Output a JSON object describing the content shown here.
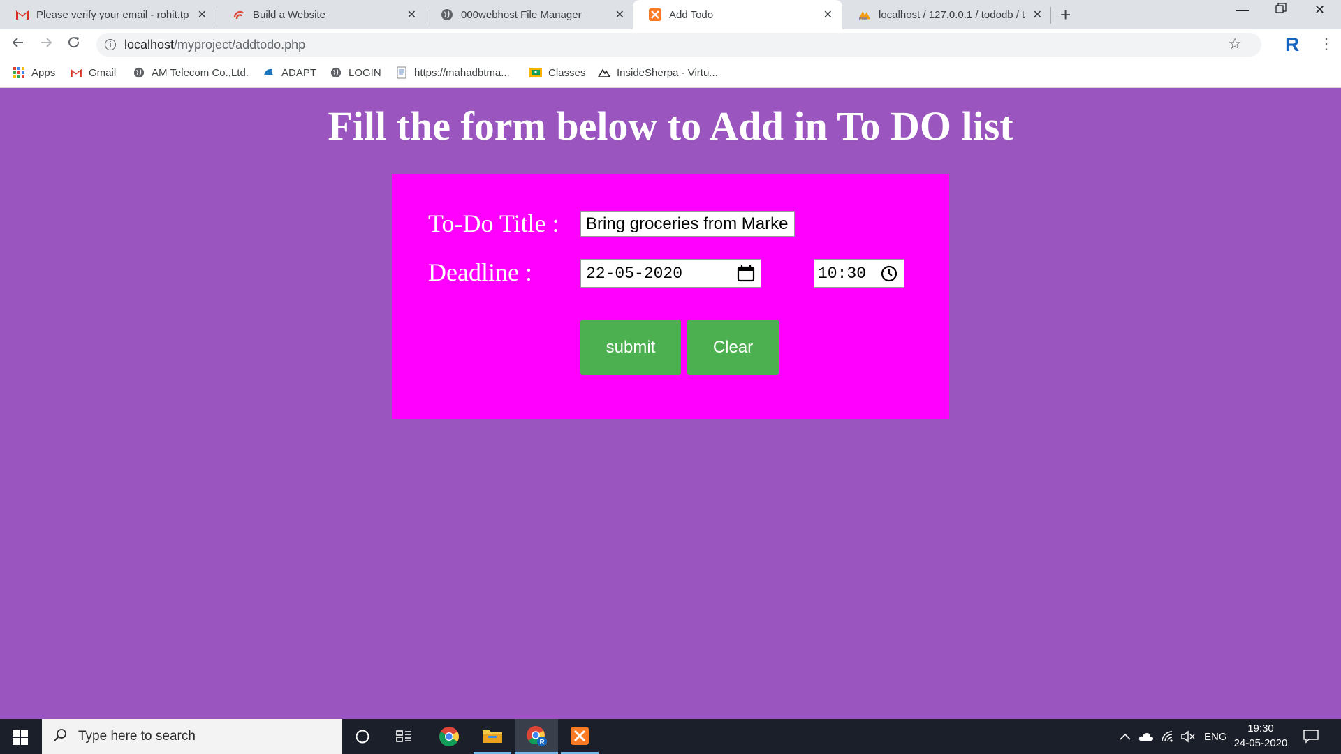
{
  "browser": {
    "tabs": [
      {
        "title": "Please verify your email - rohit.tp",
        "icon": "gmail-icon",
        "active": false
      },
      {
        "title": "Build a Website",
        "icon": "website-builder-icon",
        "active": false
      },
      {
        "title": "000webhost File Manager",
        "icon": "globe-icon",
        "active": false
      },
      {
        "title": "Add Todo",
        "icon": "xampp-icon",
        "active": true
      },
      {
        "title": "localhost / 127.0.0.1 / tododb / t",
        "icon": "phpmyadmin-icon",
        "active": false
      }
    ],
    "new_tab_label": "+",
    "address": {
      "host": "localhost",
      "path": "/myproject/addtodo.php"
    },
    "profile_initial": "R",
    "bookmarks": [
      {
        "label": "Apps",
        "icon": "apps-grid-icon"
      },
      {
        "label": "Gmail",
        "icon": "gmail-icon"
      },
      {
        "label": "AM Telecom Co.,Ltd.",
        "icon": "globe-icon"
      },
      {
        "label": "ADAPT",
        "icon": "adapt-icon"
      },
      {
        "label": "LOGIN",
        "icon": "globe-icon"
      },
      {
        "label": "https://mahadbtma...",
        "icon": "page-icon"
      },
      {
        "label": "Classes",
        "icon": "classroom-icon"
      },
      {
        "label": "InsideSherpa - Virtu...",
        "icon": "mountain-icon"
      }
    ]
  },
  "page": {
    "heading": "Fill the form below to Add in To DO list",
    "form": {
      "title_label": "To-Do Title :",
      "title_value": "Bring groceries from Marke",
      "deadline_label": "Deadline :",
      "date_value": "22-05-2020",
      "time_value": "10:30",
      "submit_label": "submit",
      "clear_label": "Clear"
    },
    "colors": {
      "background": "#9b55bf",
      "form": "#ff00ff",
      "button": "#4caf50"
    }
  },
  "taskbar": {
    "search_placeholder": "Type here to search",
    "language": "ENG",
    "time": "19:30",
    "date": "24-05-2020",
    "apps": [
      "cortana-icon",
      "task-view-icon",
      "chrome-icon",
      "file-explorer-icon",
      "chrome-profile-icon",
      "xampp-icon"
    ]
  }
}
